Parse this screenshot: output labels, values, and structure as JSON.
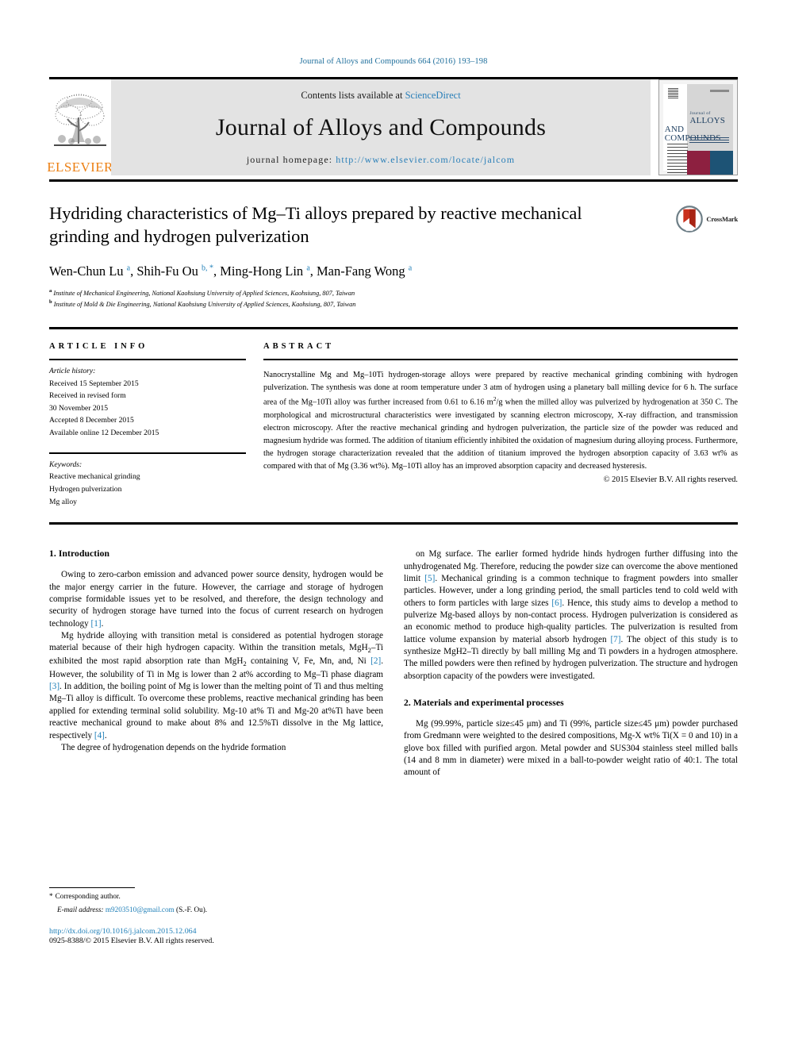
{
  "running_head": "Journal of Alloys and Compounds 664 (2016) 193–198",
  "masthead": {
    "contents_prefix": "Contents lists available at ",
    "sciencedirect": "ScienceDirect",
    "journal_title": "Journal of Alloys and Compounds",
    "homepage_label": "journal homepage: ",
    "homepage_url": "http://www.elsevier.com/locate/jalcom",
    "publisher_logo_text": "ELSEVIER",
    "cover": {
      "journal_of": "Journal of",
      "alloys": "ALLOYS",
      "and_compounds": "AND COMPOUNDS"
    },
    "colors": {
      "link_blue": "#2a7fb8",
      "elsevier_orange": "#ec8014",
      "panel_gray": "#e3e3e3",
      "cover_red": "#8d2040",
      "cover_blue": "#1d5375"
    }
  },
  "article": {
    "title": "Hydriding characteristics of Mg–Ti alloys prepared by reactive mechanical grinding and hydrogen pulverization",
    "authors_html": "Wen-Chun Lu <sup>a</sup>, Shih-Fu Ou <sup>b, *</sup>, Ming-Hong Lin <sup>a</sup>, Man-Fang Wong <sup>a</sup>",
    "affiliations": [
      "Institute of Mechanical Engineering, National Kaohsiung University of Applied Sciences, Kaohsiung, 807, Taiwan",
      "Institute of Mold & Die Engineering, National Kaohsiung University of Applied Sciences, Kaohsiung, 807, Taiwan"
    ],
    "affiliation_marks": [
      "a",
      "b"
    ],
    "crossmark_label": "CrossMark"
  },
  "article_info": {
    "heading": "ARTICLE INFO",
    "history_label": "Article history:",
    "history": [
      "Received 15 September 2015",
      "Received in revised form",
      "30 November 2015",
      "Accepted 8 December 2015",
      "Available online 12 December 2015"
    ],
    "keywords_label": "Keywords:",
    "keywords": [
      "Reactive mechanical grinding",
      "Hydrogen pulverization",
      "Mg alloy"
    ]
  },
  "abstract": {
    "heading": "ABSTRACT",
    "text_html": "Nanocrystalline Mg and Mg–10Ti hydrogen-storage alloys were prepared by reactive mechanical grinding combining with hydrogen pulverization. The synthesis was done at room temperature under 3 atm of hydrogen using a planetary ball milling device for 6 h. The surface area of the Mg–10Ti alloy was further increased from 0.61 to 6.16 m<sup>2</sup>/g when the milled alloy was pulverized by hydrogenation at 350 C. The morphological and microstructural characteristics were investigated by scanning electron microscopy, X-ray diffraction, and transmission electron microscopy. After the reactive mechanical grinding and hydrogen pulverization, the particle size of the powder was reduced and magnesium hydride was formed. The addition of titanium efficiently inhibited the oxidation of magnesium during alloying process. Furthermore, the hydrogen storage characterization revealed that the addition of titanium improved the hydrogen absorption capacity of 3.63 wt% as compared with that of Mg (3.36 wt%). Mg–10Ti alloy has an improved absorption capacity and decreased hysteresis.",
    "copyright": "© 2015 Elsevier B.V. All rights reserved."
  },
  "sections": {
    "introduction_heading": "1. Introduction",
    "materials_heading": "2. Materials and experimental processes",
    "left_paragraphs_html": [
      "Owing to zero-carbon emission and advanced power source density, hydrogen would be the major energy carrier in the future. However, the carriage and storage of hydrogen comprise formidable issues yet to be resolved, and therefore, the design technology and security of hydrogen storage have turned into the focus of current research on hydrogen technology <span class=\"ref\">[1]</span>.",
      "Mg hydride alloying with transition metal is considered as potential hydrogen storage material because of their high hydrogen capacity. Within the transition metals, MgH<sub>2</sub>–Ti exhibited the most rapid absorption rate than MgH<sub>2</sub> containing V, Fe, Mn, and, Ni <span class=\"ref\">[2]</span>. However, the solubility of Ti in Mg is lower than 2 at% according to Mg–Ti phase diagram <span class=\"ref\">[3]</span>. In addition, the boiling point of Mg is lower than the melting point of Ti and thus melting Mg–Ti alloy is difficult. To overcome these problems, reactive mechanical grinding has been applied for extending terminal solid solubility. Mg-10 at% Ti and Mg-20 at%Ti have been reactive mechanical ground to make about 8% and 12.5%Ti dissolve in the Mg lattice, respectively <span class=\"ref\">[4]</span>.",
      "The degree of hydrogenation depends on the hydride formation"
    ],
    "right_paragraphs_html": [
      "on Mg surface. The earlier formed hydride hinds hydrogen further diffusing into the unhydrogenated Mg. Therefore, reducing the powder size can overcome the above mentioned limit <span class=\"ref\">[5]</span>. Mechanical grinding is a common technique to fragment powders into smaller particles. However, under a long grinding period, the small particles tend to cold weld with others to form particles with large sizes <span class=\"ref\">[6]</span>. Hence, this study aims to develop a method to pulverize Mg-based alloys by non-contact process. Hydrogen pulverization is considered as an economic method to produce high-quality particles. The pulverization is resulted from lattice volume expansion by material absorb hydrogen <span class=\"ref\">[7]</span>. The object of this study is to synthesize MgH2–Ti directly by ball milling Mg and Ti powders in a hydrogen atmosphere. The milled powders were then refined by hydrogen pulverization. The structure and hydrogen absorption capacity of the powders were investigated."
    ],
    "materials_paragraphs_html": [
      "Mg (99.99%, particle size≤45 μm) and Ti (99%, particle size≤45 μm) powder purchased from Gredmann were weighted to the desired compositions, Mg-X wt% Ti(X = 0 and 10) in a glove box filled with purified argon. Metal powder and SUS304 stainless steel milled balls (14 and 8 mm in diameter) were mixed in a ball-to-powder weight ratio of 40:1. The total amount of"
    ]
  },
  "footnote": {
    "star": "*",
    "corresponding": "Corresponding author.",
    "email_label": "E-mail address:",
    "email": "m9203510@gmail.com",
    "email_attrib": "(S.-F. Ou).",
    "doi": "http://dx.doi.org/10.1016/j.jalcom.2015.12.064",
    "issn_html": "0925-8388/© 2015 Elsevier B.V. All rights reserved."
  }
}
